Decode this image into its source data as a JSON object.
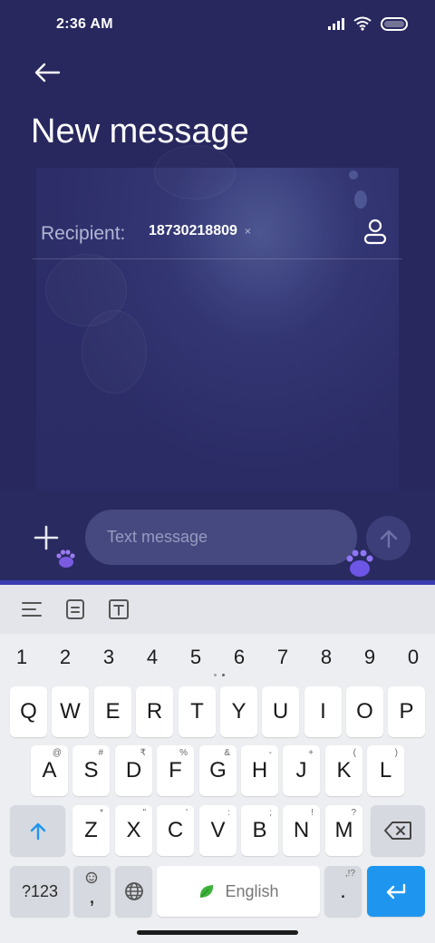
{
  "status_bar": {
    "time": "2:36 AM",
    "icons": [
      "signal-icon",
      "wifi-icon",
      "battery-icon"
    ]
  },
  "header": {
    "back_icon": "arrow-left-icon",
    "title": "New message"
  },
  "recipient": {
    "label": "Recipient:",
    "chips": [
      {
        "value": "18730218809",
        "remove_label": "×"
      }
    ],
    "contact_icon": "person-icon"
  },
  "compose": {
    "add_icon": "plus-icon",
    "placeholder": "Text message",
    "value": "",
    "send_icon": "arrow-up-icon"
  },
  "keyboard": {
    "toolbar_icons": [
      "menu-lines-icon",
      "clipboard-icon",
      "text-box-icon"
    ],
    "number_row": [
      "1",
      "2",
      "3",
      "4",
      "5",
      "6",
      "7",
      "8",
      "9",
      "0"
    ],
    "row1": [
      {
        "main": "Q",
        "sub": ""
      },
      {
        "main": "W",
        "sub": ""
      },
      {
        "main": "E",
        "sub": ""
      },
      {
        "main": "R",
        "sub": ""
      },
      {
        "main": "T",
        "sub": ""
      },
      {
        "main": "Y",
        "sub": ""
      },
      {
        "main": "U",
        "sub": ""
      },
      {
        "main": "I",
        "sub": ""
      },
      {
        "main": "O",
        "sub": ""
      },
      {
        "main": "P",
        "sub": ""
      }
    ],
    "row2": [
      {
        "main": "A",
        "sub": "@"
      },
      {
        "main": "S",
        "sub": "#"
      },
      {
        "main": "D",
        "sub": "₹"
      },
      {
        "main": "F",
        "sub": "%"
      },
      {
        "main": "G",
        "sub": "&"
      },
      {
        "main": "H",
        "sub": "-"
      },
      {
        "main": "J",
        "sub": "+"
      },
      {
        "main": "K",
        "sub": "("
      },
      {
        "main": "L",
        "sub": ")"
      }
    ],
    "row3": [
      {
        "main": "Z",
        "sub": "*"
      },
      {
        "main": "X",
        "sub": "\""
      },
      {
        "main": "C",
        "sub": "'"
      },
      {
        "main": "V",
        "sub": ":"
      },
      {
        "main": "B",
        "sub": ";"
      },
      {
        "main": "N",
        "sub": "!"
      },
      {
        "main": "M",
        "sub": "?"
      }
    ],
    "shift_icon": "shift-arrow-up-icon",
    "backspace_icon": "backspace-icon",
    "symbols_label": "?123",
    "emoji_comma": {
      "main": ",",
      "icon": "emoji-icon"
    },
    "globe_icon": "globe-icon",
    "space_label": "English",
    "space_icon": "leaf-icon",
    "period": {
      "main": ".",
      "sub": ",!?"
    },
    "enter_icon": "enter-arrow-icon"
  },
  "colors": {
    "app_background": "#28285f",
    "accent": "#1e96ef",
    "input_fill": "#45497f"
  }
}
